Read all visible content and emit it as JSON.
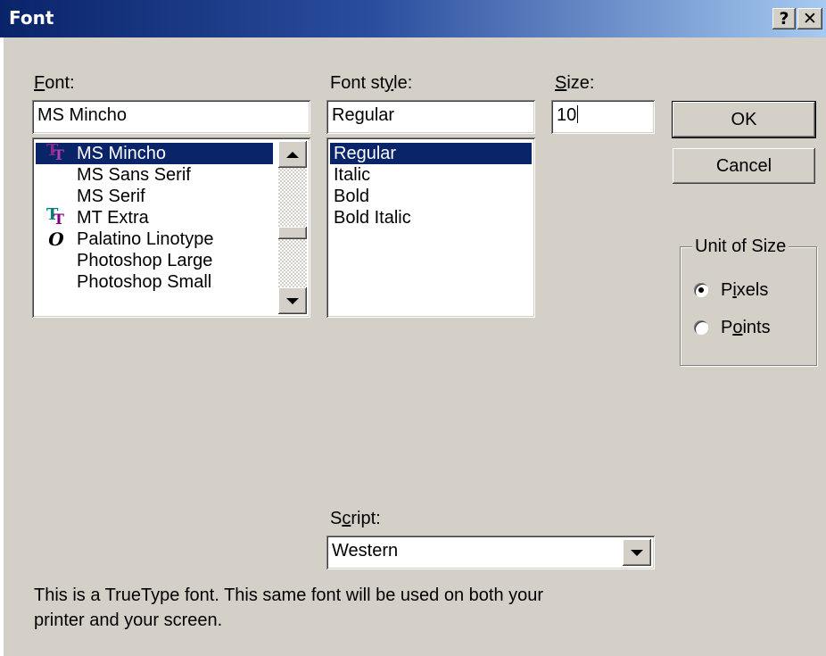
{
  "window": {
    "title": "Font",
    "help_glyph": "?",
    "close_glyph": "✕"
  },
  "font": {
    "label_key": "F",
    "label_rest": "ont:",
    "value": "MS Mincho",
    "items": [
      {
        "name": "MS Mincho",
        "icon": "truetype-icon",
        "selected": true
      },
      {
        "name": "MS Sans Serif",
        "icon": "",
        "selected": false
      },
      {
        "name": "MS Serif",
        "icon": "",
        "selected": false
      },
      {
        "name": "MT Extra",
        "icon": "truetype-icon",
        "selected": false
      },
      {
        "name": "Palatino Linotype",
        "icon": "opentype-icon",
        "selected": false
      },
      {
        "name": "Photoshop Large",
        "icon": "",
        "selected": false
      },
      {
        "name": "Photoshop Small",
        "icon": "",
        "selected": false
      }
    ],
    "scroll_position": 0.55
  },
  "font_style": {
    "label_pre": "Font st",
    "label_key": "y",
    "label_rest": "le:",
    "value": "Regular",
    "items": [
      {
        "name": "Regular",
        "selected": true
      },
      {
        "name": "Italic",
        "selected": false
      },
      {
        "name": "Bold",
        "selected": false
      },
      {
        "name": "Bold Italic",
        "selected": false
      }
    ]
  },
  "size": {
    "label_key": "S",
    "label_rest": "ize:",
    "value": "10"
  },
  "buttons": {
    "ok": "OK",
    "cancel": "Cancel"
  },
  "unit_of_size": {
    "title": "Unit of Size",
    "pixels": {
      "pre": "P",
      "key": "i",
      "rest": "xels",
      "selected": true
    },
    "points": {
      "pre": "P",
      "key": "o",
      "rest": "ints",
      "selected": false
    }
  },
  "script": {
    "label_pre": "S",
    "label_key": "c",
    "label_rest": "ript:",
    "value": "Western"
  },
  "description": {
    "line1": "This is a TrueType font. This same font will be used on both your",
    "line2": "printer and your screen."
  },
  "colors": {
    "title_start": "#0a246a",
    "title_end": "#a6caf0",
    "selection": "#0a246a",
    "face": "#d4d0c8",
    "truetype_icon_teal": "#008080",
    "truetype_icon_magenta": "#800080"
  }
}
